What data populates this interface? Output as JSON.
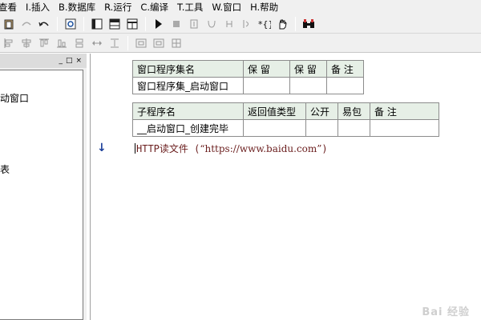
{
  "menu": {
    "items": [
      "查看",
      "I.插入",
      "B.数据库",
      "R.运行",
      "C.编译",
      "T.工具",
      "W.窗口",
      "H.帮助"
    ]
  },
  "toolbar1": {
    "icons": [
      "paste-icon",
      "disabled-redo-icon",
      "undo-icon",
      "find-icon",
      "layout-left-icon",
      "layout-top-icon",
      "layout-grid-icon",
      "run-icon",
      "stop-icon",
      "step-in-icon",
      "step-over-icon",
      "step-out-icon",
      "run-to-cursor-icon",
      "breakpoint-icon",
      "hand-icon",
      "binoculars-icon"
    ]
  },
  "toolbar2": {
    "icons": [
      "align-left-icon",
      "align-center-icon",
      "align-top-icon",
      "align-bottom-icon",
      "equal-width-icon",
      "equal-height-icon",
      "space-h-icon",
      "space-v-icon",
      "center-h-icon",
      "center-v-icon"
    ]
  },
  "left_panel": {
    "controls": [
      "_",
      "□",
      "×"
    ],
    "items": [
      "动窗口",
      "表"
    ]
  },
  "window_table": {
    "headers": [
      "窗口程序集名",
      "保 留",
      "保 留",
      "备 注"
    ],
    "row": [
      "窗口程序集_启动窗口",
      "",
      "",
      ""
    ]
  },
  "sub_table": {
    "headers": [
      "子程序名",
      "返回值类型",
      "公开",
      "易包",
      "备 注"
    ],
    "row": [
      "__启动窗口_创建完毕",
      "",
      "",
      "",
      ""
    ]
  },
  "code": {
    "marker": "↓",
    "func": "HTTP读文件",
    "open": " (",
    "arg": "“https://www.baidu.com”",
    "close": ")"
  },
  "watermark": "Bai 经验"
}
